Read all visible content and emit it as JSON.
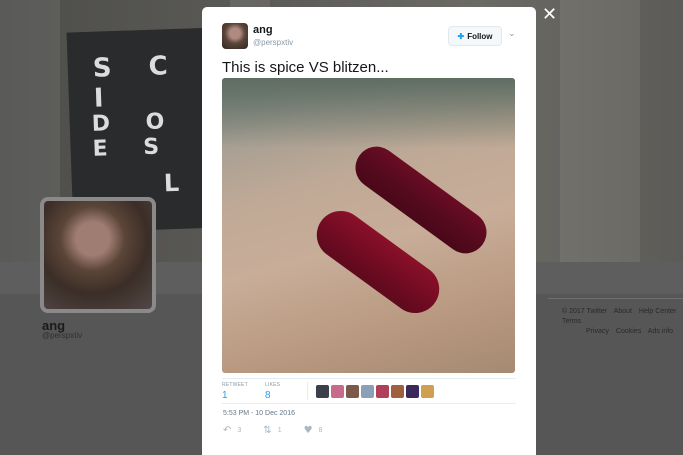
{
  "background": {
    "sign_lines": [
      "S C I",
      "D O E S",
      "L"
    ],
    "profile_name": "ang",
    "profile_handle": "@perspxtiv",
    "footer_line1": [
      "© 2017 Twitter",
      "About",
      "Help Center",
      "Terms"
    ],
    "footer_line2": [
      "Privacy",
      "Cookies",
      "Ads info"
    ]
  },
  "close_icon": "✕",
  "tweet": {
    "name": "ang",
    "handle": "@perspxtiv",
    "follow_label": "Follow",
    "text": "This is spice VS blitzen...",
    "stats": {
      "retweets_label": "RETWEET",
      "retweets": "1",
      "likes_label": "LIKES",
      "likes": "8"
    },
    "likers_colors": [
      "#3a3f4a",
      "#c86a8a",
      "#7c5a4a",
      "#8aa0b8",
      "#b0405a",
      "#a06040",
      "#3a2a5a",
      "#d0a050"
    ],
    "timestamp": "5:53 PM - 10 Dec 2016",
    "actions": {
      "reply_count": "3",
      "retweet_count": "1",
      "like_count": "8"
    }
  },
  "colors": {
    "accent": "#1da1f2",
    "swatch_spice": "#8a1029",
    "swatch_blitzen": "#5e0a1d"
  }
}
